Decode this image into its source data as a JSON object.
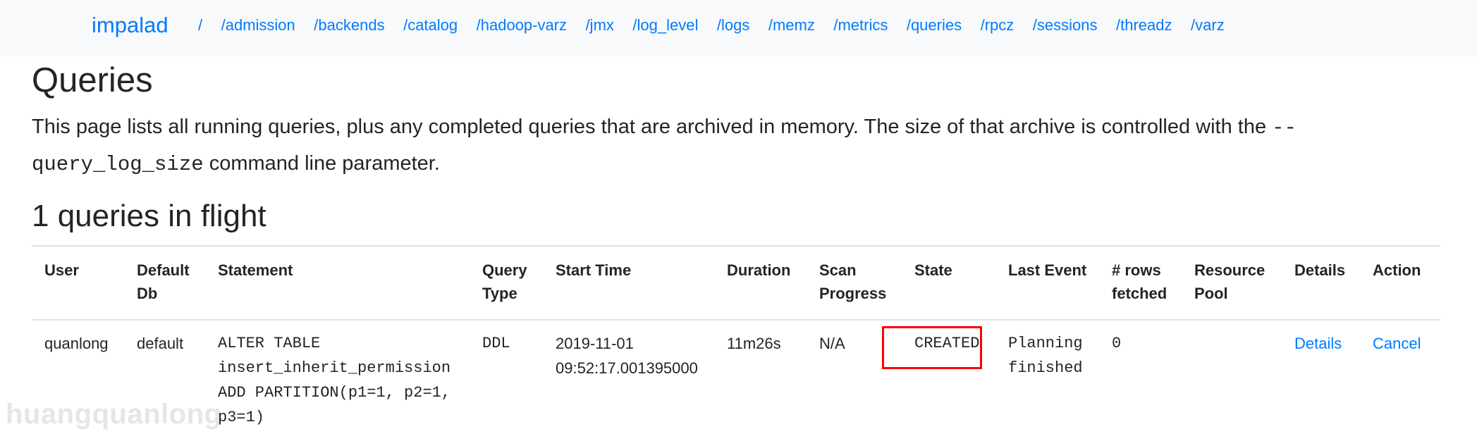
{
  "navbar": {
    "brand": "impalad",
    "links": [
      "/",
      "/admission",
      "/backends",
      "/catalog",
      "/hadoop-varz",
      "/jmx",
      "/log_level",
      "/logs",
      "/memz",
      "/metrics",
      "/queries",
      "/rpcz",
      "/sessions",
      "/threadz",
      "/varz"
    ]
  },
  "page": {
    "title": "Queries",
    "description_before": "This page lists all running queries, plus any completed queries that are archived in memory. The size of that archive is controlled with the ",
    "description_code": "--query_log_size",
    "description_after": " command line parameter.",
    "section_heading": "1 queries in flight"
  },
  "table": {
    "headers": [
      "User",
      "Default Db",
      "Statement",
      "Query Type",
      "Start Time",
      "Duration",
      "Scan Progress",
      "State",
      "Last Event",
      "# rows fetched",
      "Resource Pool",
      "Details",
      "Action"
    ],
    "rows": [
      {
        "user": "quanlong",
        "default_db": "default",
        "statement": "ALTER TABLE insert_inherit_permission ADD PARTITION(p1=1, p2=1, p3=1)",
        "query_type": "DDL",
        "start_time": "2019-11-01 09:52:17.001395000",
        "duration": "11m26s",
        "scan_progress": "N/A",
        "state": "CREATED",
        "last_event": "Planning finished",
        "rows_fetched": "0",
        "resource_pool": "",
        "details_link": "Details",
        "action_link": "Cancel"
      }
    ]
  },
  "annotation": {
    "highlight_color": "#ff0000",
    "highlighted_cell": "state"
  },
  "watermark": "huangquanlong",
  "colors": {
    "link": "#007bff",
    "navbar_bg": "#f8f9fa",
    "text": "#212529"
  }
}
